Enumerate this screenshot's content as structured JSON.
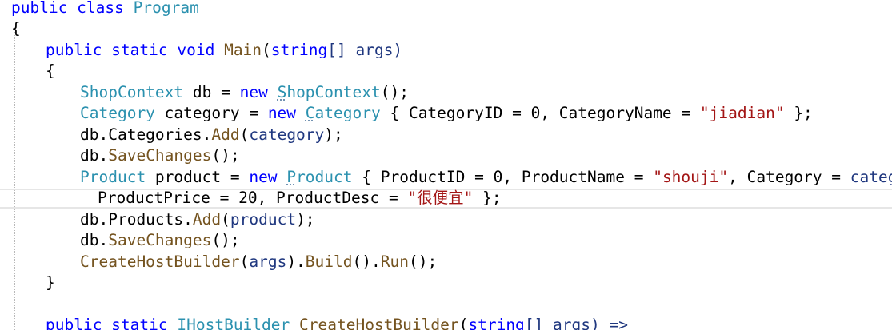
{
  "code": {
    "line1": {
      "kw": "public class",
      "type": "Program"
    },
    "line2": {
      "brace": "{"
    },
    "line3": {
      "kw": "public static void",
      "method": "Main",
      "open": "(",
      "param_type": "string",
      "rest": "[] args)"
    },
    "line4": {
      "brace": "{"
    },
    "line5": {
      "type": "ShopContext",
      "var": " db = ",
      "kw": "new",
      "ctor_first": "S",
      "ctor_rest": "hopContext",
      "end": "();"
    },
    "line6": {
      "type": "Category",
      "var": " category = ",
      "kw": "new",
      "ctor_first": "C",
      "ctor_rest": "ategory",
      "init_a": " { CategoryID = 0, CategoryName = ",
      "str": "\"jiadian\"",
      "end": " };"
    },
    "line7": {
      "obj": "db.Categories.",
      "method": "Add",
      "open": "(",
      "arg": "category",
      "end": ");"
    },
    "line8": {
      "obj": "db.",
      "method": "SaveChanges",
      "end": "();"
    },
    "line9": {
      "type": "Product",
      "var": " product = ",
      "kw": "new",
      "ctor_first": "P",
      "ctor_rest": "roduct",
      "init_a": " { ProductID = 0, ProductName = ",
      "str": "\"shouji\"",
      "init_b": ", Category = ",
      "ref": "category",
      "end": ","
    },
    "line10": {
      "init_a": "ProductPrice = 20, ProductDesc = ",
      "str": "\"很便宜\"",
      "end": " };"
    },
    "line11": {
      "obj": "db.Products.",
      "method": "Add",
      "open": "(",
      "arg": "product",
      "end": ");"
    },
    "line12": {
      "obj": "db.",
      "method": "SaveChanges",
      "end": "();"
    },
    "line13": {
      "method": "CreateHostBuilder",
      "open": "(",
      "arg": "args",
      "mid": ").",
      "method2": "Build",
      "mid2": "().",
      "method3": "Run",
      "end": "();"
    },
    "line14": {
      "brace": "}"
    },
    "line16": {
      "kw": "public static",
      "type": "IHostBuilder",
      "method": "CreateHostBuilder",
      "open": "(",
      "param_type": "string",
      "rest": "[] args) =>"
    }
  },
  "colors": {
    "keyword": "#0000ff",
    "type": "#2b91af",
    "string": "#a31515",
    "method": "#74531f",
    "parameter": "#1f377f"
  }
}
